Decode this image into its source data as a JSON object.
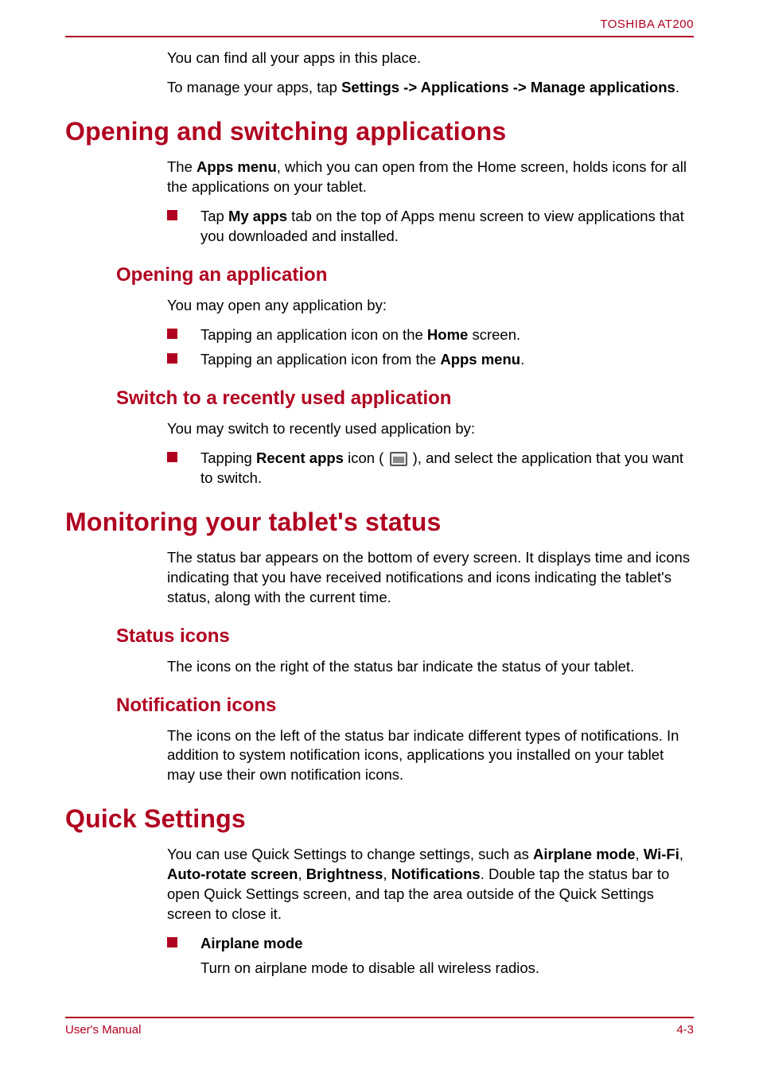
{
  "header": {
    "product": "TOSHIBA AT200"
  },
  "intro": {
    "p1": "You can find all your apps in this place.",
    "p2_pre": "To manage your apps, tap ",
    "p2_bold": "Settings -> Applications -> Manage applications",
    "p2_post": "."
  },
  "s1": {
    "title": "Opening and switching applications",
    "p1_pre": "The ",
    "p1_b": "Apps menu",
    "p1_post": ", which you can open from the Home screen, holds icons for all the applications on your tablet.",
    "li1_pre": "Tap ",
    "li1_b": "My apps",
    "li1_post": " tab on the top of Apps menu screen to view applications that you downloaded and installed."
  },
  "s1a": {
    "title": "Opening an application",
    "p1": "You may open any application by:",
    "li1_pre": "Tapping an application icon on the ",
    "li1_b": "Home",
    "li1_post": " screen.",
    "li2_pre": "Tapping an application icon from the ",
    "li2_b": "Apps menu",
    "li2_post": "."
  },
  "s1b": {
    "title": "Switch to a recently used application",
    "p1": "You may switch to recently used application by:",
    "li1_pre": "Tapping ",
    "li1_b": "Recent apps",
    "li1_mid": " icon ( ",
    "li1_post": " ), and select the application that you want to switch."
  },
  "s2": {
    "title": "Monitoring your tablet's status",
    "p1": "The status bar appears on the bottom of every screen. It displays time and icons indicating that you have received notifications and icons indicating the tablet's status, along with the current time."
  },
  "s2a": {
    "title": "Status icons",
    "p1": "The icons on the right of the status bar indicate the status of your tablet."
  },
  "s2b": {
    "title": "Notification icons",
    "p1": "The icons on the left of the status bar indicate different types of notifications. In addition to system notification icons, applications you installed on your tablet may use their own notification icons."
  },
  "s3": {
    "title": "Quick Settings",
    "p1_pre": "You can use Quick Settings to change settings, such as ",
    "p1_b1": "Airplane mode",
    "p1_c1": ", ",
    "p1_b2": "Wi-Fi",
    "p1_c2": ", ",
    "p1_b3": "Auto-rotate screen",
    "p1_c3": ", ",
    "p1_b4": "Brightness",
    "p1_c4": ", ",
    "p1_b5": "Notifications",
    "p1_post": ". Double tap the status bar to open Quick Settings screen, and tap the area outside of the Quick Settings screen to close it.",
    "li1_b": "Airplane mode",
    "li1_sub": "Turn on airplane mode to disable all wireless radios."
  },
  "footer": {
    "left": "User's Manual",
    "right": "4-3"
  }
}
